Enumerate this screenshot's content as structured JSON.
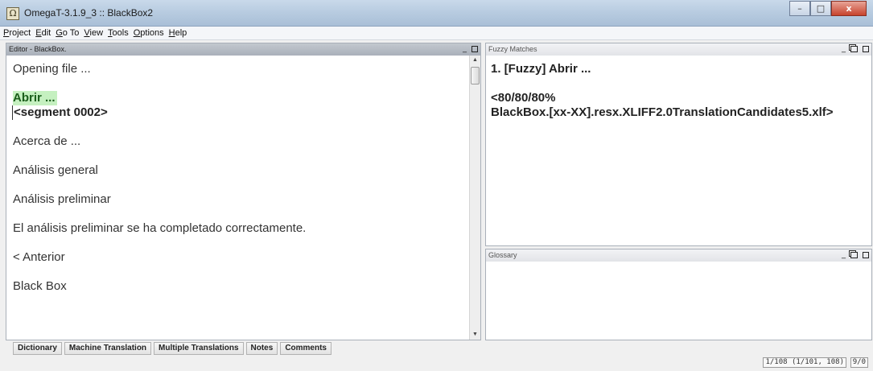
{
  "window": {
    "title": "OmegaT-3.1.9_3 :: BlackBox2",
    "minimize_glyph": "–",
    "maximize_glyph": "□",
    "close_glyph": "x",
    "icon": "omegat-app-icon"
  },
  "menu": [
    {
      "accel": "P",
      "rest": "roject"
    },
    {
      "accel": "E",
      "rest": "dit"
    },
    {
      "accel": "G",
      "rest": "o To"
    },
    {
      "accel": "V",
      "rest": "iew"
    },
    {
      "accel": "T",
      "rest": "ools"
    },
    {
      "accel": "O",
      "rest": "ptions"
    },
    {
      "accel": "H",
      "rest": "elp"
    }
  ],
  "editor": {
    "header": "Editor - BlackBox.",
    "segments": [
      {
        "text": "Opening file ..."
      },
      {
        "source": "Abrir ...",
        "target": "<segment 0002>"
      },
      {
        "text": "Acerca de ..."
      },
      {
        "text": "Análisis general"
      },
      {
        "text": "Análisis preliminar"
      },
      {
        "text": "El análisis preliminar se ha completado correctamente."
      },
      {
        "text": "< Anterior"
      },
      {
        "text": "Black Box"
      }
    ]
  },
  "fuzzy": {
    "header": "Fuzzy Matches",
    "line1": "1. [Fuzzy] Abrir ...",
    "line2": "<80/80/80%",
    "line3": "BlackBox.[xx-XX].resx.XLIFF2.0TranslationCandidates5.xlf>"
  },
  "glossary": {
    "header": "Glossary"
  },
  "tabs": [
    "Dictionary",
    "Machine Translation",
    "Multiple Translations",
    "Notes",
    "Comments"
  ],
  "status": {
    "progress": "1/108 (1/101, 108)",
    "chars": "9/0"
  },
  "colors": {
    "active_source_bg": "#c5f0c0",
    "titlebar": "#b7cbe0"
  }
}
